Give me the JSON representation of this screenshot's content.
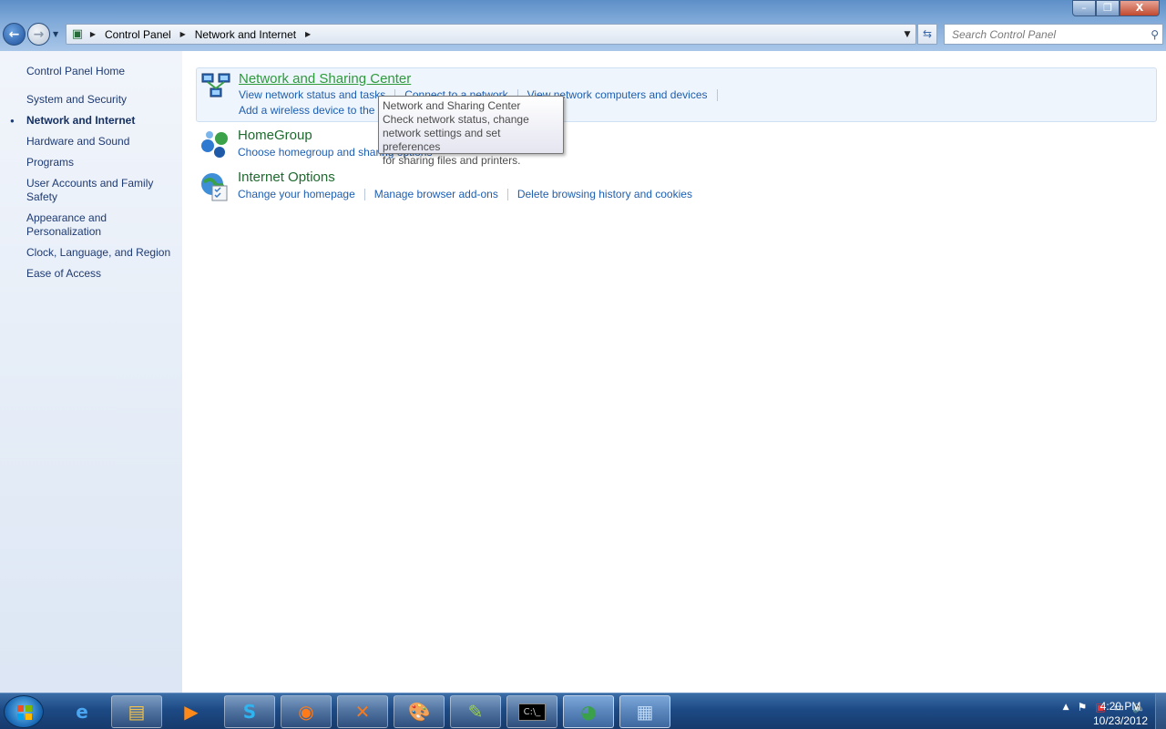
{
  "window": {
    "minimize_label": "–",
    "restore_label": "❐",
    "close_label": "X"
  },
  "nav": {
    "back_label": "←",
    "forward_label": "→"
  },
  "address": {
    "crumbs": [
      "Control Panel",
      "Network and Internet"
    ]
  },
  "search": {
    "placeholder": "Search Control Panel"
  },
  "sidebar": {
    "home": "Control Panel Home",
    "items": [
      {
        "label": "System and Security"
      },
      {
        "label": "Network and Internet",
        "active": true
      },
      {
        "label": "Hardware and Sound"
      },
      {
        "label": "Programs"
      },
      {
        "label": "User Accounts and Family Safety"
      },
      {
        "label": "Appearance and Personalization"
      },
      {
        "label": "Clock, Language, and Region"
      },
      {
        "label": "Ease of Access"
      }
    ]
  },
  "categories": [
    {
      "title": "Network and Sharing Center",
      "icon": "network-icon",
      "links_row1": [
        "View network status and tasks",
        "Connect to a network",
        "View network computers and devices"
      ],
      "links_row2": [
        "Add a wireless device to the network"
      ]
    },
    {
      "title": "HomeGroup",
      "icon": "homegroup-icon",
      "links_row1": [
        "Choose homegroup and sharing options"
      ]
    },
    {
      "title": "Internet Options",
      "icon": "internet-options-icon",
      "links_row1": [
        "Change your homepage",
        "Manage browser add-ons",
        "Delete browsing history and cookies"
      ]
    }
  ],
  "tooltip": {
    "line1": "Network and Sharing Center",
    "line2": "Check network status, change",
    "line3": "network settings and set preferences",
    "line4": "for sharing files and printers."
  },
  "taskbar": {
    "items": [
      "internet-explorer-icon",
      "windows-explorer-icon",
      "media-player-icon",
      "skype-icon",
      "firefox-icon",
      "xampp-icon",
      "paint-icon",
      "notepad-plus-plus-icon",
      "command-prompt-icon",
      "network-app-icon",
      "control-panel-icon"
    ],
    "time": "4:20 PM",
    "date": "10/23/2012"
  },
  "colors": {
    "link": "#1e5eb0",
    "category_title": "#1e6a2e",
    "taskbar": "#1d4a85"
  }
}
